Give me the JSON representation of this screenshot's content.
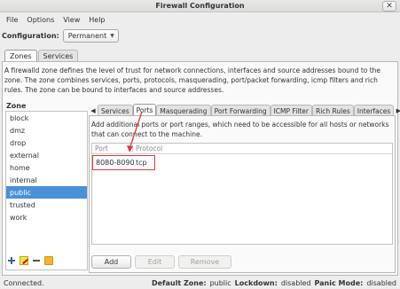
{
  "window": {
    "title": "Firewall Configuration",
    "close_glyph": "✕"
  },
  "menu": [
    "File",
    "Options",
    "View",
    "Help"
  ],
  "configuration": {
    "label": "Configuration:",
    "value": "Permanent"
  },
  "outer_tabs": [
    "Zones",
    "Services"
  ],
  "zones": {
    "description": "A firewalld zone defines the level of trust for network connections, interfaces and source addresses bound to the zone. The zone combines services, ports, protocols, masquerading, port/packet forwarding, icmp filters and rich rules. The zone can be bound to interfaces and source addresses.",
    "list_label": "Zone",
    "items": [
      "block",
      "dmz",
      "drop",
      "external",
      "home",
      "internal",
      "public",
      "trusted",
      "work"
    ],
    "selected": "public"
  },
  "inner_tabs": [
    "Services",
    "Ports",
    "Masquerading",
    "Port Forwarding",
    "ICMP Filter",
    "Rich Rules",
    "Interfaces"
  ],
  "ports": {
    "description": "Add additional ports or port ranges, which need to be accessible for all hosts or networks that can connect to the machine.",
    "columns": [
      "Port",
      "Protocol"
    ],
    "rows": [
      {
        "port": "8080-8090",
        "protocol": "tcp"
      }
    ],
    "buttons": {
      "add": "Add",
      "edit": "Edit",
      "remove": "Remove"
    }
  },
  "status": {
    "connection": "Connected.",
    "default_zone_label": "Default Zone:",
    "default_zone_value": "public",
    "lockdown_label": "Lockdown:",
    "lockdown_value": "disabled",
    "panic_label": "Panic Mode:",
    "panic_value": "disabled"
  },
  "colors": {
    "selection": "#4a90d9",
    "annotation": "#e0393e"
  },
  "icons": [
    "add-icon",
    "edit-icon",
    "remove-icon",
    "load-defaults-icon",
    "scroll-left-icon",
    "scroll-right-icon"
  ]
}
